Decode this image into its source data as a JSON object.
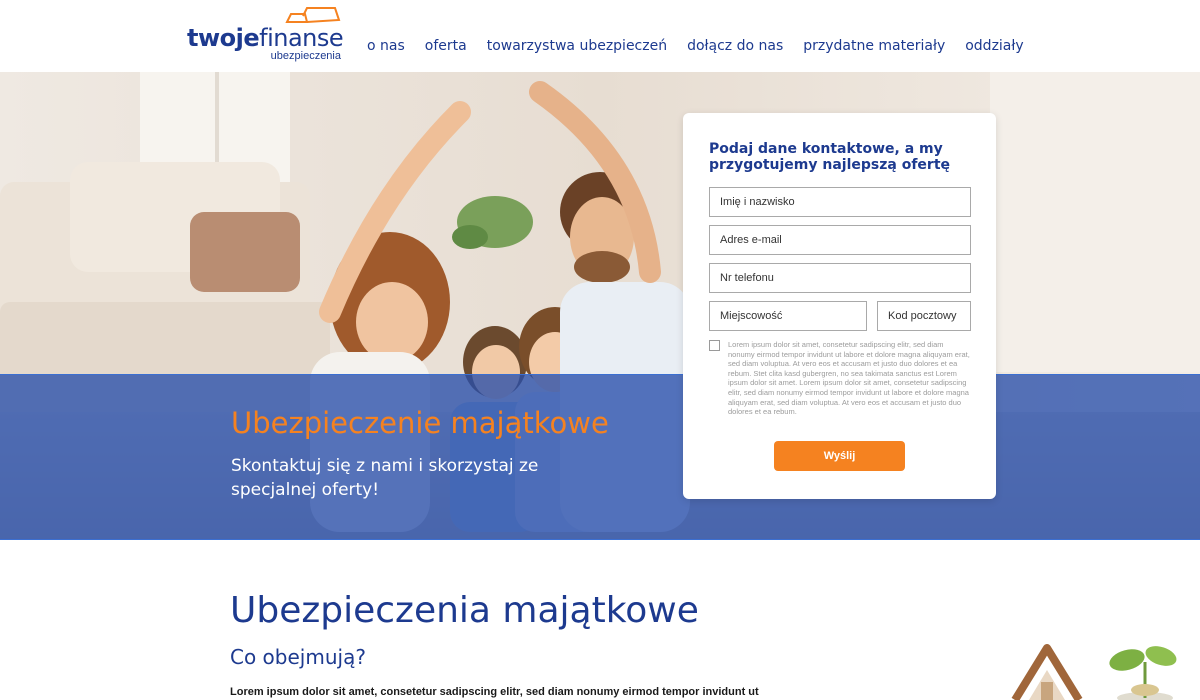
{
  "brand": {
    "logo_word_bold": "twoje",
    "logo_word_light": "finanse",
    "logo_sub": "ubezpieczenia",
    "accent_orange": "#f58220",
    "primary_blue": "#1d3a8f"
  },
  "nav": {
    "items": [
      "o nas",
      "oferta",
      "towarzystwa ubezpieczeń",
      "dołącz do nas",
      "przydatne materiały",
      "oddziały"
    ]
  },
  "hero": {
    "title": "Ubezpieczenie majątkowe",
    "subtitle": "Skontaktuj się z nami i skorzystaj ze specjalnej oferty!"
  },
  "form": {
    "heading": "Podaj dane kontaktowe, a my przygotujemy najlepszą ofertę",
    "name_placeholder": "Imię i nazwisko",
    "email_placeholder": "Adres e-mail",
    "phone_placeholder": "Nr telefonu",
    "city_placeholder": "Miejscowość",
    "zip_placeholder": "Kod pocztowy",
    "consent_text": "Lorem ipsum dolor sit amet, consetetur sadipscing elitr, sed diam nonumy eirmod tempor invidunt ut labore et dolore magna aliquyam erat, sed diam voluptua. At vero eos et accusam et justo duo dolores et ea rebum. Stet clita kasd gubergren, no sea takimata sanctus est Lorem ipsum dolor sit amet. Lorem ipsum dolor sit amet, consetetur sadipscing elitr, sed diam nonumy eirmod tempor invidunt ut labore et dolore magna aliquyam erat, sed diam voluptua. At vero eos et accusam et justo duo dolores et ea rebum.",
    "consent_checked": false,
    "submit_label": "Wyślij"
  },
  "content": {
    "title": "Ubezpieczenia majątkowe",
    "subtitle": "Co obejmują?",
    "body": "Lorem ipsum dolor sit amet, consetetur sadipscing elitr, sed diam nonumy eirmod tempor invidunt ut"
  }
}
